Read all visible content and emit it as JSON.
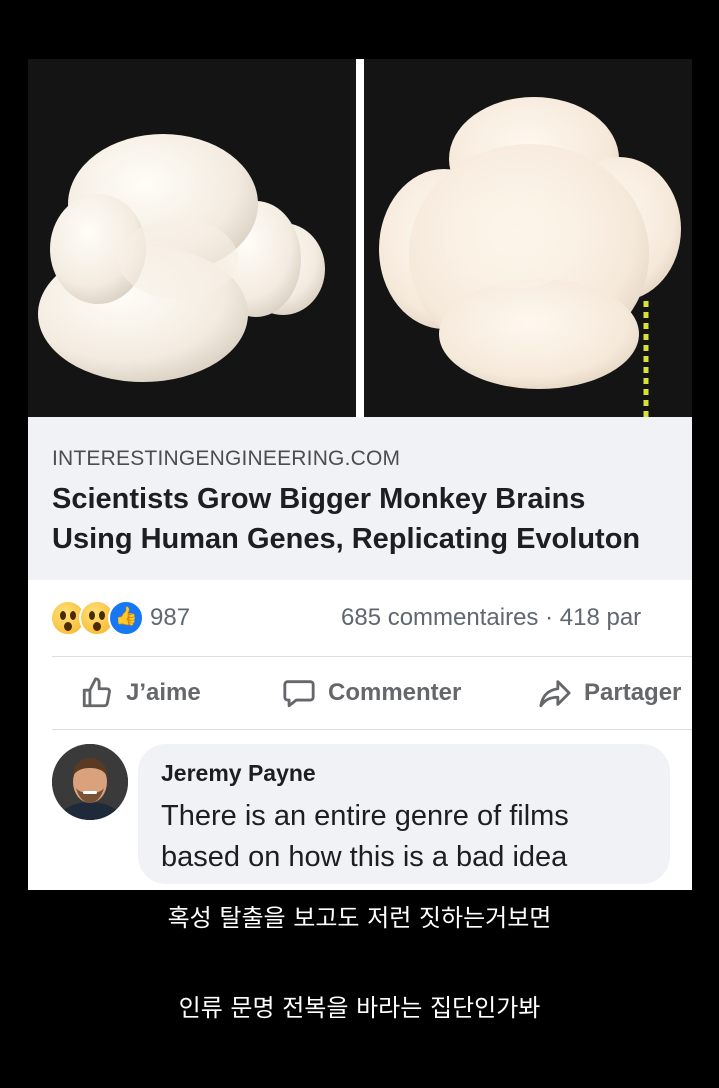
{
  "article": {
    "domain": "INTERESTINGENGINEERING.COM",
    "headline_line1": "Scientists Grow Bigger Monkey Brains",
    "headline_line2": "Using Human Genes, Replicating Evoluton"
  },
  "stats": {
    "reaction_icons": [
      "wow-icon",
      "wow-icon",
      "like-icon"
    ],
    "reaction_count": "987",
    "comments_shares": "685 commentaires · 418 par"
  },
  "actions": {
    "like_label": "J’aime",
    "comment_label": "Commenter",
    "share_label": "Partager"
  },
  "comment": {
    "author": "Jeremy Payne",
    "text_line1": "There is an entire genre of films",
    "text_line2": "based on how this is a bad idea"
  },
  "captions": {
    "line1": "혹성 탈출을 보고도 저런 짓하는거보면",
    "line2": "인류 문명 전복을 바라는 집단인가봐"
  },
  "colors": {
    "background": "#000000",
    "link_area": "#f0f2f5",
    "like_blue": "#1877f2",
    "scale_marker": "#d8e03a"
  }
}
